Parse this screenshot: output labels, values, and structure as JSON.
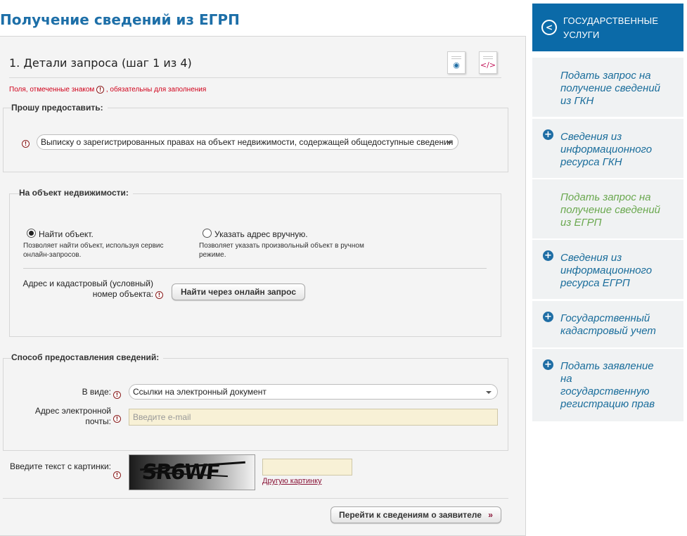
{
  "page": {
    "title": "Получение сведений из ЕГРП"
  },
  "step": {
    "title": "1. Детали запроса (шаг 1 из 4)",
    "required_prefix": "Поля, отмеченные знаком",
    "required_suffix": ", обязательны для заполнения",
    "preview_icon": "eye-document-icon",
    "code_icon": "code-document-icon",
    "required_glyph": "!"
  },
  "request": {
    "legend": "Прошу предоставить:",
    "selected": "Выписку о зарегистрированных правах на объект недвижимости, содержащей общедоступные сведения"
  },
  "object": {
    "legend": "На объект недвижимости:",
    "option1_label": "Найти объект.",
    "option1_desc_l1": "Позволяет найти объект, используя сервис",
    "option1_desc_l2": "онлайн-запросов.",
    "option2_label": "Указать адрес вручную.",
    "option2_desc_l1": "Позволяет указать произвольный объект в ручном",
    "option2_desc_l2": "режиме.",
    "address_label_l1": "Адрес и кадастровый (условный)",
    "address_label_l2": "номер объекта:",
    "find_button": "Найти через онлайн запрос"
  },
  "delivery": {
    "legend": "Способ предоставления сведений:",
    "view_label": "В виде:",
    "view_value": "Ссылки на электронный документ",
    "email_label_l1": "Адрес электронной",
    "email_label_l2": "почты:",
    "email_placeholder": "Введите e-mail"
  },
  "captcha": {
    "label": "Введите текст с картинки:",
    "image_text": "SR6WF",
    "other_link": "Другую картинку"
  },
  "next_button": "Перейти к сведениям о заявителе",
  "next_arrow": "»",
  "sidebar": {
    "header_l1": "ГОСУДАРСТВЕННЫЕ",
    "header_l2": "УСЛУГИ",
    "back_glyph": "<",
    "plus_glyph": "+",
    "items": [
      {
        "l1": "Подать запрос на",
        "l2": "получение сведений",
        "l3": "из ГКН"
      },
      {
        "l1": "Сведения из",
        "l2": "информационного",
        "l3": "ресурса ГКН"
      },
      {
        "l1": "Подать запрос на",
        "l2": "получение сведений",
        "l3": "из ЕГРП"
      },
      {
        "l1": "Сведения из",
        "l2": "информационного",
        "l3": "ресурса ЕГРП"
      },
      {
        "l1": "Государственный",
        "l2": "кадастровый учет"
      },
      {
        "l1": "Подать заявление",
        "l2": "на",
        "l3": "государственную",
        "l4": "регистрацию прав"
      }
    ]
  },
  "colors": {
    "brand": "#0b6aa8",
    "active_link": "#6aa84f",
    "link": "#1a6d9b",
    "required": "#d0021b"
  }
}
